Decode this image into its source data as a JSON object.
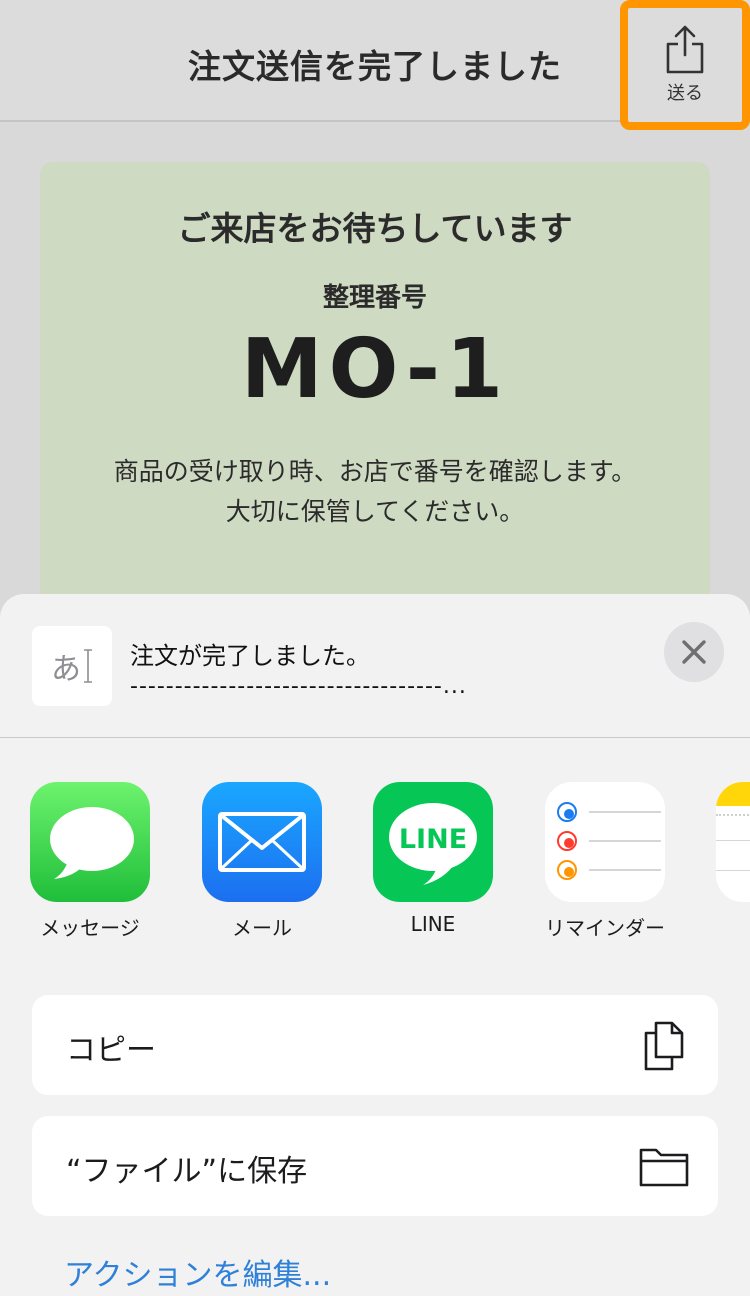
{
  "navbar": {
    "title": "注文送信を完了しました",
    "share_label": "送る",
    "share_icon": "share-icon",
    "highlight_color": "#ff9500"
  },
  "card": {
    "heading": "ご来店をお待ちしています",
    "number_label": "整理番号",
    "number": "MO-1",
    "note_line1": "商品の受け取り時、お店で番号を確認します。",
    "note_line2": "大切に保管してください。",
    "background_color": "#cfdac3"
  },
  "share_sheet": {
    "preview": {
      "thumb_text": "あ",
      "title": "注文が完了しました。",
      "subtitle": "-----------------------------------..."
    },
    "apps": [
      {
        "label": "メッセージ",
        "icon": "messages-icon"
      },
      {
        "label": "メール",
        "icon": "mail-icon"
      },
      {
        "label": "LINE",
        "icon": "line-icon",
        "icon_text": "LINE"
      },
      {
        "label": "リマインダー",
        "icon": "reminders-icon"
      },
      {
        "label": "",
        "icon": "notes-icon"
      }
    ],
    "actions": [
      {
        "label": "コピー",
        "icon": "copy-icon"
      },
      {
        "label": "“ファイル”に保存",
        "icon": "folder-icon"
      }
    ],
    "edit_actions_label": "アクションを編集...",
    "link_color": "#2f80d8"
  }
}
